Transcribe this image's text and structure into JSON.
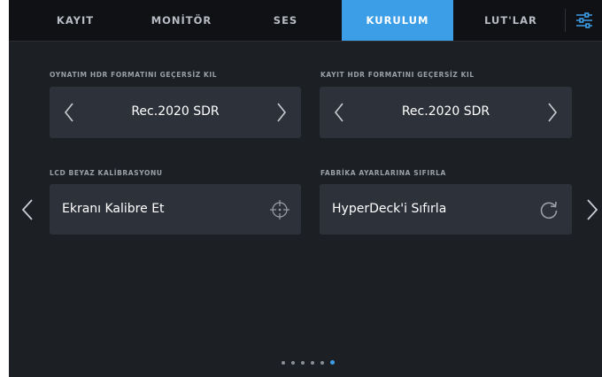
{
  "tabs": [
    {
      "label": "KAYIT"
    },
    {
      "label": "MONİTÖR"
    },
    {
      "label": "SES"
    },
    {
      "label": "KURULUM"
    },
    {
      "label": "LUT'LAR"
    }
  ],
  "active_tab": "KURULUM",
  "sections": {
    "playback_hdr": {
      "label": "OYNATIM HDR FORMATINI GEÇERSİZ KIL",
      "value": "Rec.2020 SDR"
    },
    "record_hdr": {
      "label": "KAYIT HDR FORMATINI GEÇERSİZ KIL",
      "value": "Rec.2020 SDR"
    },
    "lcd_calibration": {
      "label": "LCD BEYAZ KALİBRASYONU",
      "button": "Ekranı Kalibre Et",
      "icon": "crosshair-icon"
    },
    "factory_reset": {
      "label": "FABRİKA AYARLARINA SIFIRLA",
      "button": "HyperDeck'i Sıfırla",
      "icon": "reset-icon"
    }
  },
  "pagination": {
    "total": 6,
    "current": 6
  },
  "colors": {
    "accent": "#3d9ee8",
    "background": "#1c1f24",
    "card": "#2d3139",
    "tabbar": "#0f1114"
  }
}
